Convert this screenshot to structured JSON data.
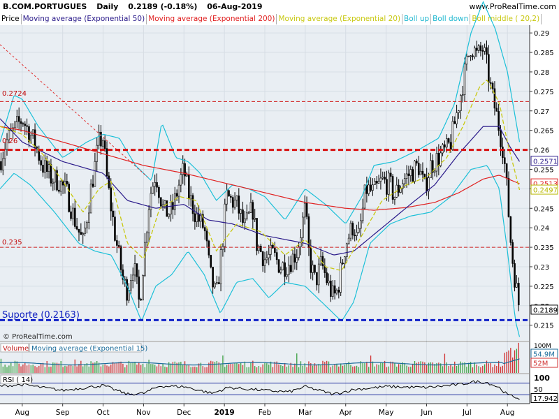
{
  "header": {
    "symbol": "B.COM.PORTUGUES",
    "period": "Daily",
    "quote": "0.2189 (-0.18%)",
    "date": "06-Aug-2019",
    "website": "www.ProRealTime.com"
  },
  "legend": [
    {
      "label": "Price",
      "color": "#000000"
    },
    {
      "label": "Moving average (Exponential 50)",
      "color": "#2a1a8a"
    },
    {
      "label": "Moving average (Exponential 200)",
      "color": "#e02020"
    },
    {
      "label": "Moving average (Exponential 20)",
      "color": "#c8c810"
    },
    {
      "label": "Boll up",
      "color": "#20b8d0"
    },
    {
      "label": "Boll down",
      "color": "#20b8d0"
    },
    {
      "label": "Boll middle ( 20,2)",
      "color": "#c8c810"
    }
  ],
  "copyright": "© ProRealTime.com",
  "levels": {
    "resistance_label": "0.2724",
    "resistance_value": 0.2724,
    "mid_label": "0.26",
    "mid_value": 0.26,
    "low_label": "0.235",
    "low_value": 0.235,
    "support_label": "Suporte (0.2163)",
    "support_value": 0.2163
  },
  "badges": [
    {
      "text": "0.2571",
      "value": 0.2571,
      "color": "#2a1a8a"
    },
    {
      "text": "0.2513",
      "value": 0.2513,
      "color": "#e02020"
    },
    {
      "text": "0.2497",
      "value": 0.2497,
      "color": "#b8b800"
    },
    {
      "text": "0.2189",
      "value": 0.2189,
      "color": "#000000"
    }
  ],
  "volume_panel": {
    "title": "Volume",
    "ma_label": "Moving average (Exponential 15)",
    "axis_top": "100M",
    "ma_badge": "54.9M",
    "vol_badge": "52M",
    "ylim": [
      0,
      100
    ]
  },
  "rsi_panel": {
    "title": "RSI ( 14)",
    "axis_top": "100",
    "axis_mid": "50",
    "value_badge": "17.942",
    "upper": 70,
    "lower": 30,
    "ylim": [
      0,
      100
    ]
  },
  "chart_data": {
    "type": "line",
    "ylim": [
      0.211,
      0.292
    ],
    "y_ticks": [
      "0.215",
      "0.22",
      "0.225",
      "0.23",
      "0.235",
      "0.24",
      "0.245",
      "0.25",
      "0.255",
      "0.26",
      "0.265",
      "0.27",
      "0.275",
      "0.28",
      "0.285",
      "0.29"
    ],
    "x_ticks": [
      {
        "label": "Aug",
        "month": 1
      },
      {
        "label": "Sep",
        "month": 2
      },
      {
        "label": "Oct",
        "month": 3
      },
      {
        "label": "Nov",
        "month": 4
      },
      {
        "label": "Dec",
        "month": 5
      },
      {
        "label": "2019",
        "month": 6,
        "bold": true
      },
      {
        "label": "Feb",
        "month": 7
      },
      {
        "label": "Mar",
        "month": 8
      },
      {
        "label": "Apr",
        "month": 9
      },
      {
        "label": "May",
        "month": 10
      },
      {
        "label": "Jun",
        "month": 11
      },
      {
        "label": "Jul",
        "month": 12
      },
      {
        "label": "Aug",
        "month": 13
      }
    ],
    "x_range": [
      0.45,
      13.55
    ],
    "price_anchors": [
      [
        0.45,
        0.257
      ],
      [
        0.6,
        0.262
      ],
      [
        0.8,
        0.265
      ],
      [
        1.0,
        0.268
      ],
      [
        1.1,
        0.266
      ],
      [
        1.3,
        0.262
      ],
      [
        1.5,
        0.256
      ],
      [
        1.7,
        0.253
      ],
      [
        1.9,
        0.252
      ],
      [
        2.1,
        0.249
      ],
      [
        2.3,
        0.242
      ],
      [
        2.5,
        0.236
      ],
      [
        2.7,
        0.25
      ],
      [
        2.9,
        0.262
      ],
      [
        3.0,
        0.263
      ],
      [
        3.1,
        0.252
      ],
      [
        3.3,
        0.238
      ],
      [
        3.5,
        0.226
      ],
      [
        3.6,
        0.224
      ],
      [
        3.75,
        0.231
      ],
      [
        3.9,
        0.22
      ],
      [
        4.0,
        0.232
      ],
      [
        4.15,
        0.248
      ],
      [
        4.3,
        0.254
      ],
      [
        4.5,
        0.244
      ],
      [
        4.7,
        0.244
      ],
      [
        4.9,
        0.252
      ],
      [
        5.0,
        0.255
      ],
      [
        5.1,
        0.249
      ],
      [
        5.3,
        0.243
      ],
      [
        5.5,
        0.24
      ],
      [
        5.65,
        0.228
      ],
      [
        5.8,
        0.222
      ],
      [
        5.95,
        0.236
      ],
      [
        6.05,
        0.248
      ],
      [
        6.3,
        0.246
      ],
      [
        6.5,
        0.24
      ],
      [
        6.7,
        0.245
      ],
      [
        6.8,
        0.236
      ],
      [
        7.0,
        0.232
      ],
      [
        7.2,
        0.233
      ],
      [
        7.4,
        0.23
      ],
      [
        7.6,
        0.231
      ],
      [
        7.8,
        0.234
      ],
      [
        8.0,
        0.245
      ],
      [
        8.1,
        0.232
      ],
      [
        8.25,
        0.226
      ],
      [
        8.4,
        0.231
      ],
      [
        8.55,
        0.226
      ],
      [
        8.7,
        0.222
      ],
      [
        8.8,
        0.224
      ],
      [
        9.0,
        0.236
      ],
      [
        9.2,
        0.241
      ],
      [
        9.3,
        0.236
      ],
      [
        9.5,
        0.25
      ],
      [
        9.7,
        0.249
      ],
      [
        9.9,
        0.252
      ],
      [
        10.1,
        0.251
      ],
      [
        10.2,
        0.248
      ],
      [
        10.4,
        0.252
      ],
      [
        10.6,
        0.254
      ],
      [
        10.8,
        0.256
      ],
      [
        10.95,
        0.25
      ],
      [
        11.1,
        0.256
      ],
      [
        11.3,
        0.258
      ],
      [
        11.5,
        0.26
      ],
      [
        11.6,
        0.262
      ],
      [
        11.8,
        0.272
      ],
      [
        11.95,
        0.28
      ],
      [
        12.1,
        0.287
      ],
      [
        12.25,
        0.284
      ],
      [
        12.4,
        0.286
      ],
      [
        12.5,
        0.281
      ],
      [
        12.6,
        0.275
      ],
      [
        12.75,
        0.268
      ],
      [
        12.9,
        0.26
      ],
      [
        13.0,
        0.248
      ],
      [
        13.1,
        0.234
      ],
      [
        13.2,
        0.226
      ],
      [
        13.3,
        0.219
      ]
    ],
    "ema50_anchors": [
      [
        0.45,
        0.268
      ],
      [
        1.0,
        0.262
      ],
      [
        2.0,
        0.257
      ],
      [
        3.0,
        0.254
      ],
      [
        3.6,
        0.247
      ],
      [
        4.3,
        0.245
      ],
      [
        5.0,
        0.246
      ],
      [
        5.6,
        0.242
      ],
      [
        6.2,
        0.241
      ],
      [
        7.0,
        0.238
      ],
      [
        8.0,
        0.236
      ],
      [
        8.7,
        0.233
      ],
      [
        9.2,
        0.234
      ],
      [
        9.9,
        0.24
      ],
      [
        10.6,
        0.246
      ],
      [
        11.2,
        0.251
      ],
      [
        11.8,
        0.259
      ],
      [
        12.4,
        0.266
      ],
      [
        12.8,
        0.266
      ],
      [
        13.05,
        0.261
      ],
      [
        13.3,
        0.257
      ]
    ],
    "ema200_anchors": [
      [
        0.45,
        0.266
      ],
      [
        1.0,
        0.265
      ],
      [
        2.0,
        0.262
      ],
      [
        3.0,
        0.259
      ],
      [
        4.0,
        0.256
      ],
      [
        5.0,
        0.254
      ],
      [
        6.0,
        0.2515
      ],
      [
        7.0,
        0.249
      ],
      [
        8.0,
        0.2465
      ],
      [
        9.0,
        0.245
      ],
      [
        9.7,
        0.2445
      ],
      [
        10.5,
        0.2452
      ],
      [
        11.2,
        0.2465
      ],
      [
        11.8,
        0.249
      ],
      [
        12.4,
        0.2525
      ],
      [
        12.8,
        0.2535
      ],
      [
        13.3,
        0.2513
      ]
    ],
    "ema20_anchors": [
      [
        0.45,
        0.266
      ],
      [
        1.0,
        0.264
      ],
      [
        1.5,
        0.259
      ],
      [
        2.0,
        0.252
      ],
      [
        2.5,
        0.244
      ],
      [
        2.9,
        0.25
      ],
      [
        3.2,
        0.252
      ],
      [
        3.6,
        0.236
      ],
      [
        4.0,
        0.232
      ],
      [
        4.4,
        0.245
      ],
      [
        4.9,
        0.248
      ],
      [
        5.3,
        0.247
      ],
      [
        5.8,
        0.234
      ],
      [
        6.3,
        0.241
      ],
      [
        6.9,
        0.239
      ],
      [
        7.5,
        0.233
      ],
      [
        8.0,
        0.237
      ],
      [
        8.5,
        0.23
      ],
      [
        8.9,
        0.229
      ],
      [
        9.4,
        0.238
      ],
      [
        9.9,
        0.247
      ],
      [
        10.5,
        0.251
      ],
      [
        11.0,
        0.253
      ],
      [
        11.5,
        0.258
      ],
      [
        11.9,
        0.266
      ],
      [
        12.3,
        0.276
      ],
      [
        12.5,
        0.278
      ],
      [
        12.8,
        0.272
      ],
      [
        13.0,
        0.262
      ],
      [
        13.3,
        0.2497
      ]
    ],
    "boll_up_anchors": [
      [
        0.45,
        0.262
      ],
      [
        0.8,
        0.274
      ],
      [
        1.0,
        0.273
      ],
      [
        1.4,
        0.266
      ],
      [
        2.0,
        0.258
      ],
      [
        2.6,
        0.262
      ],
      [
        3.0,
        0.264
      ],
      [
        3.4,
        0.263
      ],
      [
        3.8,
        0.256
      ],
      [
        4.2,
        0.252
      ],
      [
        4.45,
        0.267
      ],
      [
        4.8,
        0.258
      ],
      [
        5.1,
        0.257
      ],
      [
        5.4,
        0.254
      ],
      [
        5.8,
        0.247
      ],
      [
        6.2,
        0.251
      ],
      [
        6.6,
        0.25
      ],
      [
        7.0,
        0.248
      ],
      [
        7.5,
        0.242
      ],
      [
        8.0,
        0.25
      ],
      [
        8.5,
        0.246
      ],
      [
        9.0,
        0.241
      ],
      [
        9.4,
        0.248
      ],
      [
        9.7,
        0.256
      ],
      [
        10.2,
        0.257
      ],
      [
        10.8,
        0.26
      ],
      [
        11.3,
        0.263
      ],
      [
        11.7,
        0.272
      ],
      [
        12.1,
        0.29
      ],
      [
        12.4,
        0.298
      ],
      [
        12.7,
        0.291
      ],
      [
        13.0,
        0.28
      ],
      [
        13.3,
        0.262
      ]
    ],
    "boll_down_anchors": [
      [
        0.45,
        0.25
      ],
      [
        0.8,
        0.254
      ],
      [
        1.2,
        0.251
      ],
      [
        1.8,
        0.244
      ],
      [
        2.4,
        0.236
      ],
      [
        2.8,
        0.234
      ],
      [
        3.2,
        0.233
      ],
      [
        3.6,
        0.225
      ],
      [
        3.95,
        0.216
      ],
      [
        4.3,
        0.225
      ],
      [
        4.7,
        0.228
      ],
      [
        5.1,
        0.234
      ],
      [
        5.5,
        0.228
      ],
      [
        5.9,
        0.218
      ],
      [
        6.3,
        0.226
      ],
      [
        6.7,
        0.227
      ],
      [
        7.1,
        0.222
      ],
      [
        7.5,
        0.226
      ],
      [
        8.0,
        0.225
      ],
      [
        8.4,
        0.221
      ],
      [
        8.9,
        0.216
      ],
      [
        9.2,
        0.221
      ],
      [
        9.6,
        0.236
      ],
      [
        10.1,
        0.241
      ],
      [
        10.6,
        0.243
      ],
      [
        11.1,
        0.244
      ],
      [
        11.6,
        0.248
      ],
      [
        12.1,
        0.255
      ],
      [
        12.5,
        0.256
      ],
      [
        12.8,
        0.25
      ],
      [
        13.0,
        0.234
      ],
      [
        13.2,
        0.216
      ],
      [
        13.3,
        0.212
      ]
    ],
    "rsi_anchors": [
      [
        0.45,
        60
      ],
      [
        1.0,
        65
      ],
      [
        2.0,
        45
      ],
      [
        3.0,
        62
      ],
      [
        3.6,
        32
      ],
      [
        4.0,
        35
      ],
      [
        4.4,
        60
      ],
      [
        5.0,
        58
      ],
      [
        5.7,
        35
      ],
      [
        6.1,
        55
      ],
      [
        7.0,
        45
      ],
      [
        7.6,
        40
      ],
      [
        8.0,
        58
      ],
      [
        8.7,
        32
      ],
      [
        9.2,
        48
      ],
      [
        10.0,
        58
      ],
      [
        11.0,
        55
      ],
      [
        11.8,
        65
      ],
      [
        12.2,
        75
      ],
      [
        12.5,
        72
      ],
      [
        12.8,
        55
      ],
      [
        13.0,
        30
      ],
      [
        13.3,
        18
      ]
    ]
  }
}
